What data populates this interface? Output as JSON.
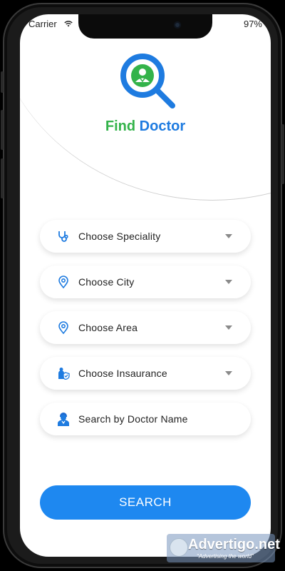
{
  "status_bar": {
    "carrier": "Carrier",
    "battery": "97"
  },
  "brand": {
    "title_part1": "Find",
    "title_part2": "Doctor",
    "green": "#33b34a",
    "blue": "#1e7be0"
  },
  "fields": [
    {
      "label": "Choose Speciality",
      "icon": "stethoscope-icon",
      "dropdown": true
    },
    {
      "label": "Choose City",
      "icon": "location-pin-icon",
      "dropdown": true
    },
    {
      "label": "Choose Area",
      "icon": "location-pin-icon",
      "dropdown": true
    },
    {
      "label": "Choose Insaurance",
      "icon": "insurance-shield-icon",
      "dropdown": true
    },
    {
      "label": "Search by Doctor Name",
      "icon": "doctor-icon",
      "dropdown": false
    }
  ],
  "search_button": {
    "label": "SEARCH",
    "color": "#1e88f0"
  },
  "watermark": {
    "main": "Advertigo.net",
    "sub": "\"Advertising the world\""
  }
}
